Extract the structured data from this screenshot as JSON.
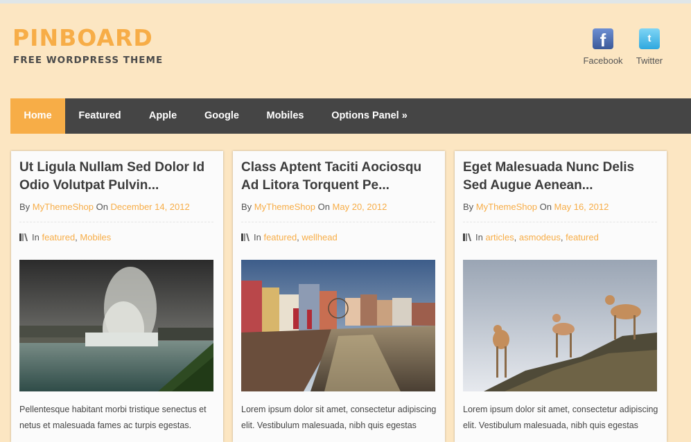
{
  "site": {
    "logo": "PINBOARD",
    "tagline": "FREE WORDPRESS THEME",
    "social": [
      {
        "label": "Facebook",
        "icon": "facebook-icon",
        "glyph": "f",
        "color": "#3b5998"
      },
      {
        "label": "Twitter",
        "icon": "twitter-icon",
        "glyph": "t",
        "color": "#2fa8df"
      }
    ]
  },
  "nav": {
    "items": [
      {
        "label": "Home",
        "active": true
      },
      {
        "label": "Featured"
      },
      {
        "label": "Apple"
      },
      {
        "label": "Google"
      },
      {
        "label": "Mobiles"
      },
      {
        "label": "Options Panel »"
      }
    ]
  },
  "colors": {
    "accent": "#f7ad47",
    "nav_bg": "#454545",
    "page_bg": "#fce6c2"
  },
  "posts": [
    {
      "title": "Ut Ligula Nullam Sed Dolor Id Odio Volutpat Pulvin...",
      "by": "By",
      "author": "MyThemeShop",
      "on": "On",
      "date": "December 14, 2012",
      "in": "In",
      "cats": [
        "featured",
        "Mobiles"
      ],
      "image": "waterfall-photo",
      "excerpt": "Pellentesque habitant morbi tristique senectus et netus et malesuada fames ac turpis egestas."
    },
    {
      "title": "Class Aptent Taciti Aociosqu Ad Litora Torquent Pe...",
      "by": "By",
      "author": "MyThemeShop",
      "on": "On",
      "date": "May 20, 2012",
      "in": "In",
      "cats": [
        "featured",
        "wellhead"
      ],
      "image": "canal-town-photo",
      "excerpt": "Lorem ipsum dolor sit amet, consectetur adipiscing elit. Vestibulum malesuada, nibh quis egestas"
    },
    {
      "title": "Eget Malesuada Nunc Delis Sed Augue Aenean...",
      "by": "By",
      "author": "MyThemeShop",
      "on": "On",
      "date": "May 16, 2012",
      "in": "In",
      "cats": [
        "articles",
        "asmodeus",
        "featured"
      ],
      "image": "deer-photo",
      "excerpt": "Lorem ipsum dolor sit amet, consectetur adipiscing elit. Vestibulum malesuada, nibh quis egestas"
    }
  ]
}
